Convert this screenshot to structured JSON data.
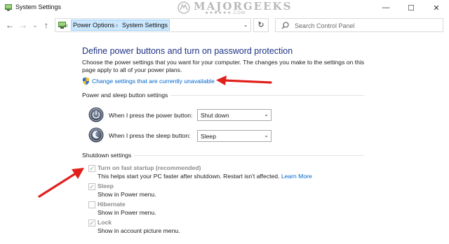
{
  "window": {
    "title": "System Settings",
    "minimize_glyph": "—",
    "maximize_glyph": "☐",
    "close_glyph": "✕"
  },
  "watermark": {
    "text": "MAJORGEEKS",
    "stars": "★★★★★★.COM"
  },
  "nav": {
    "back_glyph": "←",
    "forward_glyph": "→",
    "recent_glyph": "⌄",
    "up_glyph": "↑",
    "crumb_prefix": "«",
    "crumbs": [
      "Power Options",
      "System Settings"
    ],
    "crumb_sep": "›",
    "dropdown_glyph": "⌄",
    "refresh_glyph": "↻",
    "search_placeholder": "Search Control Panel"
  },
  "main": {
    "heading": "Define power buttons and turn on password protection",
    "description": "Choose the power settings that you want for your computer. The changes you make to the settings on this page apply to all of your power plans.",
    "change_link": "Change settings that are currently unavailable",
    "power_section": {
      "title": "Power and sleep button settings",
      "rows": [
        {
          "label": "When I press the power button:",
          "value": "Shut down"
        },
        {
          "label": "When I press the sleep button:",
          "value": "Sleep"
        }
      ]
    },
    "shutdown_section": {
      "title": "Shutdown settings",
      "items": [
        {
          "label": "Turn on fast startup (recommended)",
          "description": "This helps start your PC faster after shutdown. Restart isn't affected.",
          "link": "Learn More",
          "checked": true
        },
        {
          "label": "Sleep",
          "description": "Show in Power menu.",
          "checked": true
        },
        {
          "label": "Hibernate",
          "description": "Show in Power menu.",
          "checked": false
        },
        {
          "label": "Lock",
          "description": "Show in account picture menu.",
          "checked": true
        }
      ]
    }
  },
  "colors": {
    "heading": "#1e3287",
    "link": "#0066cc",
    "arrow": "#e0201b",
    "crumb_highlight": "#cce8ff"
  }
}
